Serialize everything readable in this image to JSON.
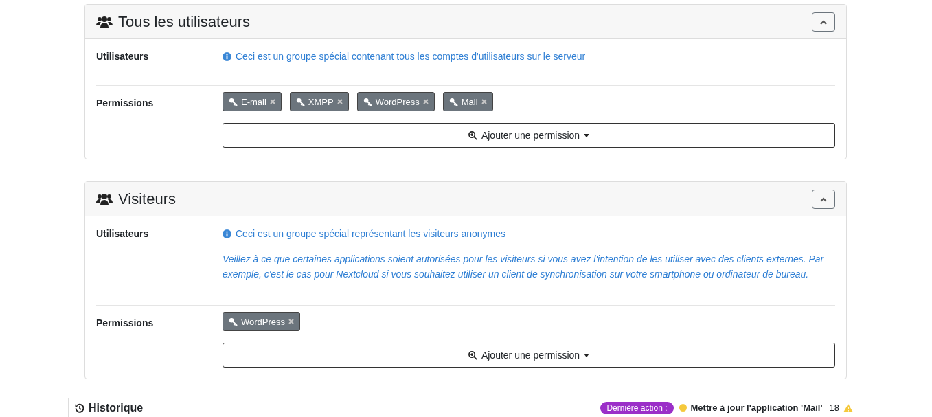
{
  "panels": [
    {
      "title": "Tous les utilisateurs",
      "expanded": true,
      "users_label": "Utilisateurs",
      "info": "Ceci est un groupe spécial contenant tous les comptes d'utilisateurs sur le serveur",
      "permissions_label": "Permissions",
      "permissions": [
        "E-mail",
        "XMPP",
        "WordPress",
        "Mail"
      ],
      "add_button": "Ajouter une permission"
    },
    {
      "title": "Visiteurs",
      "expanded": true,
      "users_label": "Utilisateurs",
      "info": "Ceci est un groupe spécial représentant les visiteurs anonymes",
      "note": "Veillez à ce que certaines applications soient autorisées pour les visiteurs si vous avez l'intention de les utiliser avec des clients externes. Par exemple, c'est le cas pour Nextcloud si vous souhaitez utiliser un client de synchronisation sur votre smartphone ou ordinateur de bureau.",
      "permissions_label": "Permissions",
      "permissions": [
        "WordPress"
      ],
      "add_button": "Ajouter une permission"
    }
  ],
  "history_bar": {
    "title": "Historique",
    "last_action_label": "Dernière action :",
    "last_action": "Mettre à jour l'application 'Mail'",
    "count": "18"
  }
}
